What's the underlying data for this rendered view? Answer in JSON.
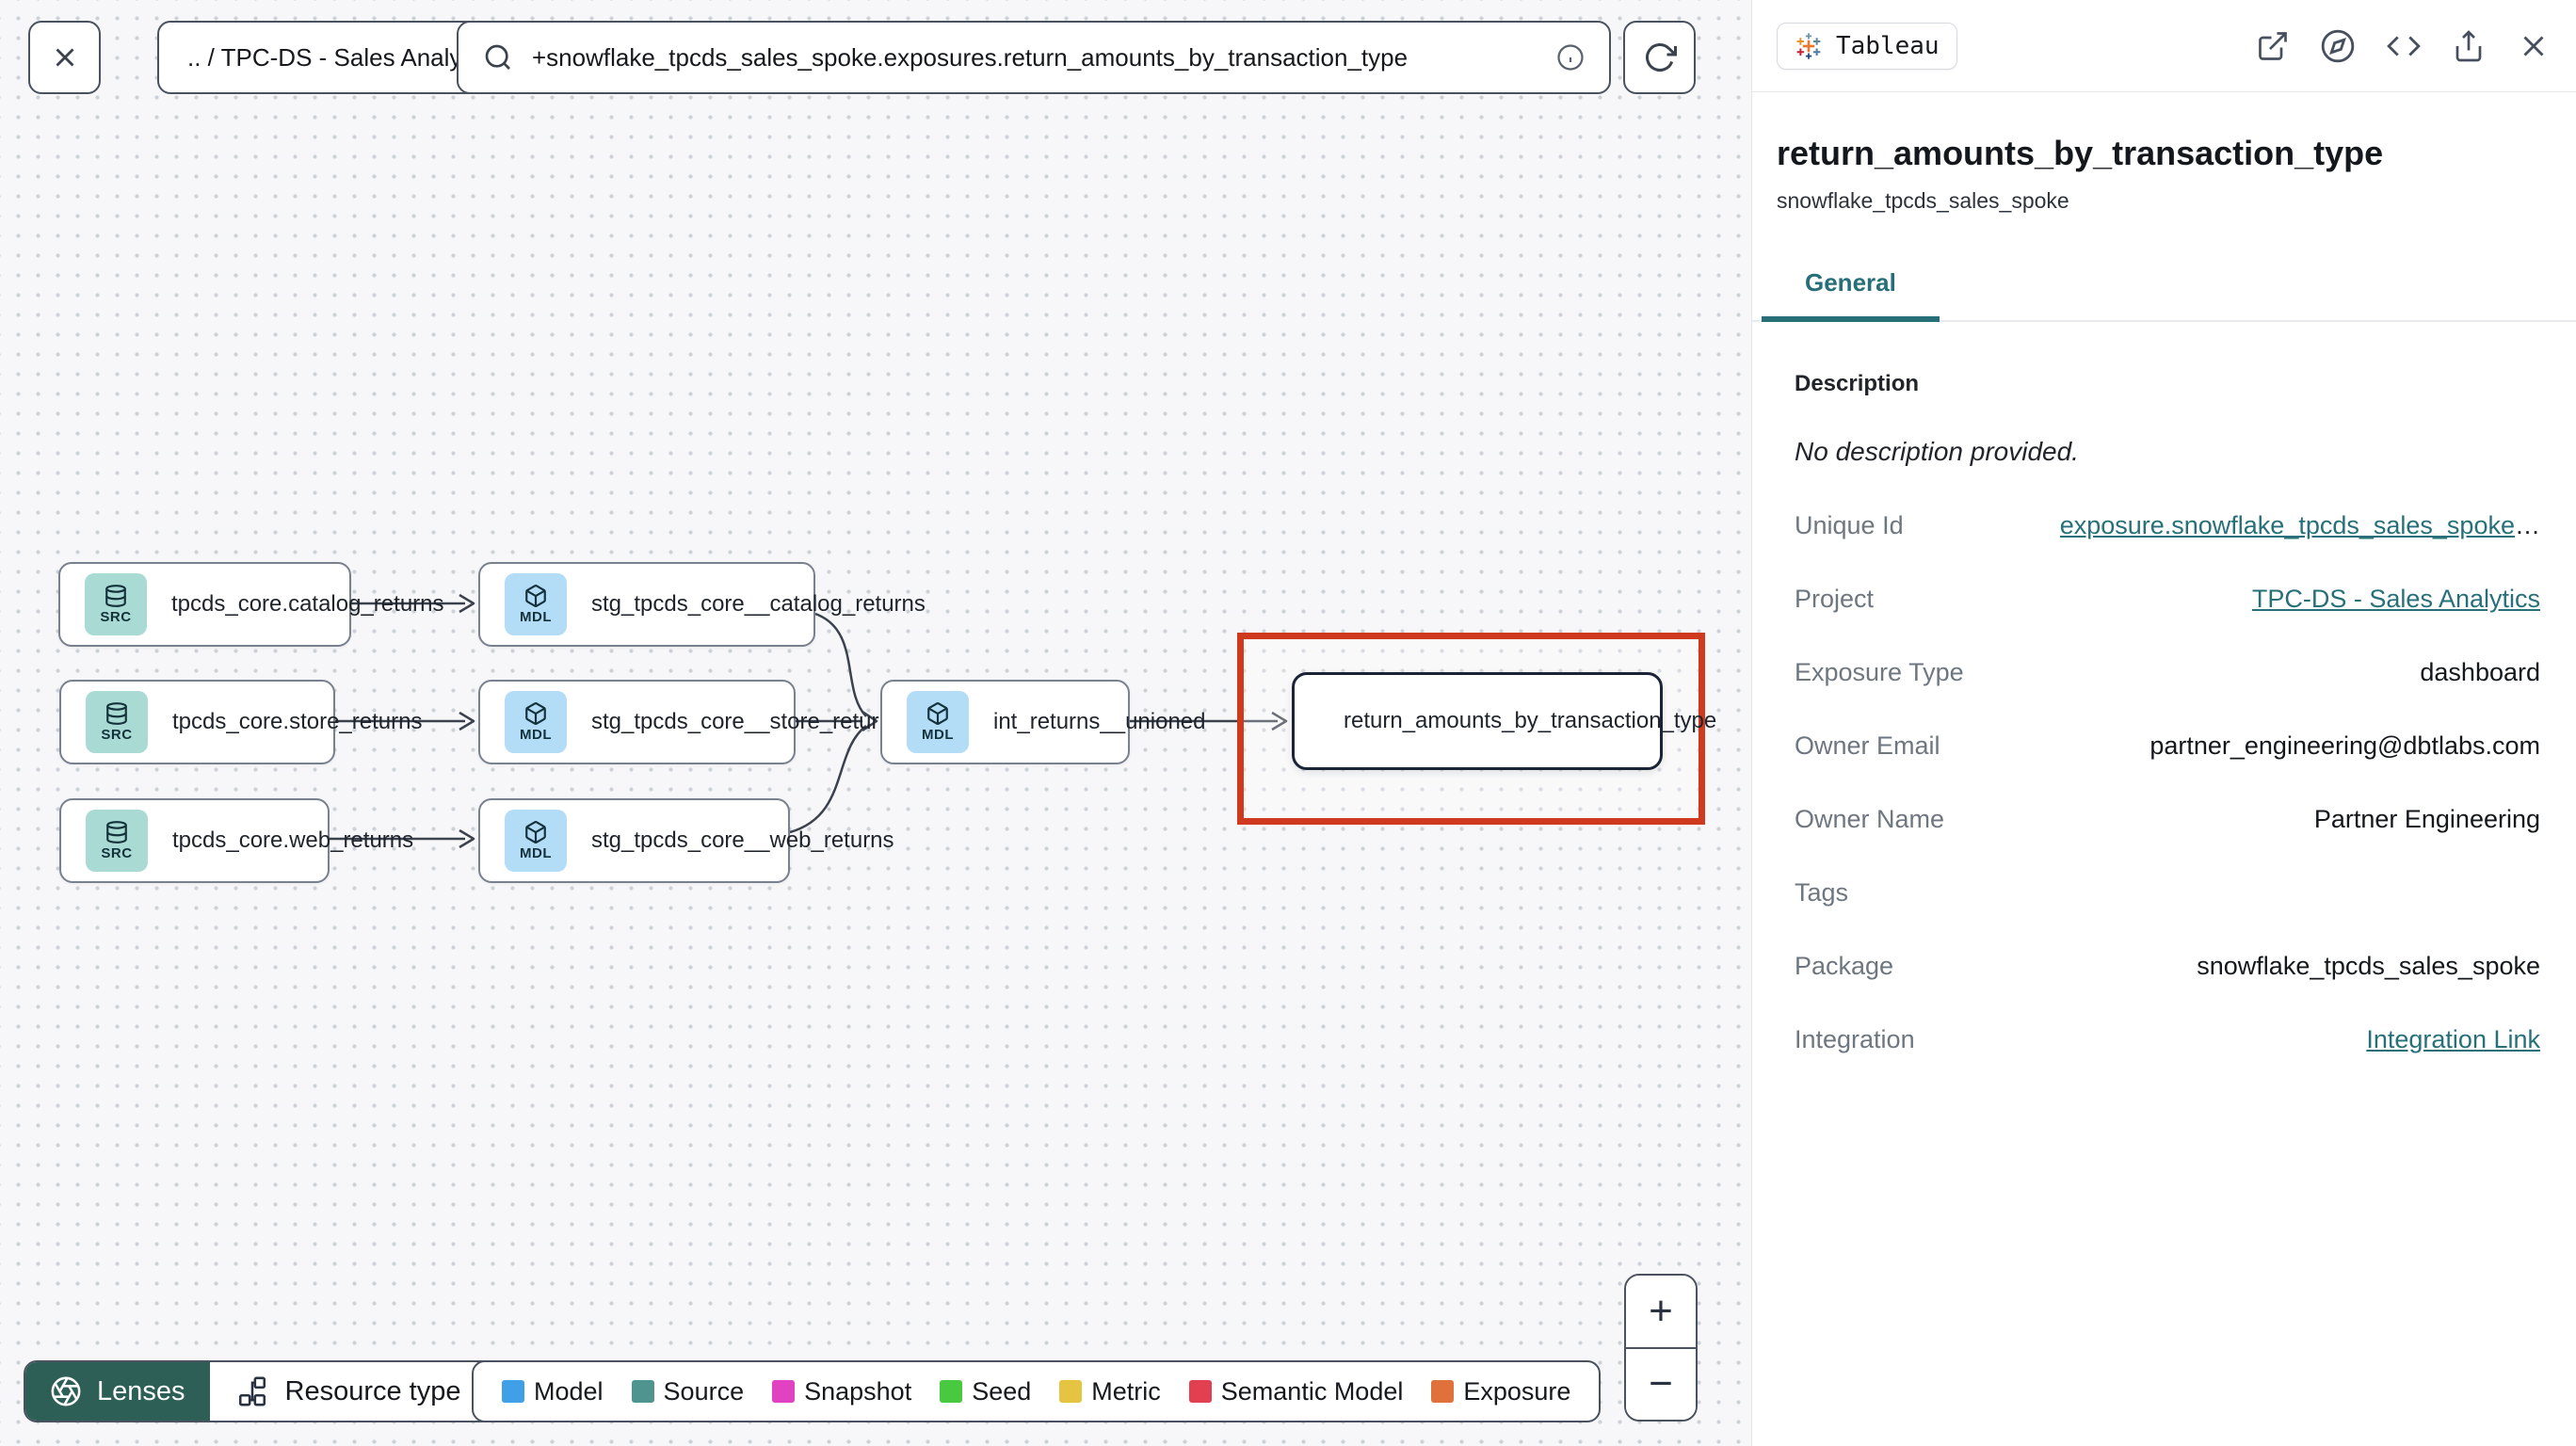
{
  "header": {
    "breadcrumb": ".. / TPC-DS - Sales Analytics",
    "search_value": "+snowflake_tpcds_sales_spoke.exposures.return_amounts_by_transaction_type"
  },
  "panel": {
    "integration_badge": "Tableau",
    "title": "return_amounts_by_transaction_type",
    "subtitle": "snowflake_tpcds_sales_spoke",
    "tab": "General",
    "description_label": "Description",
    "description_empty": "No description provided.",
    "rows": [
      {
        "label": "Unique Id",
        "value": "exposure.snowflake_tpcds_sales_spoke",
        "suffix": "…"
      },
      {
        "label": "Project",
        "value": "TPC-DS - Sales Analytics"
      },
      {
        "label": "Exposure Type",
        "value": "dashboard"
      },
      {
        "label": "Owner Email",
        "value": "partner_engineering@dbtlabs.com"
      },
      {
        "label": "Owner Name",
        "value": "Partner Engineering"
      },
      {
        "label": "Tags",
        "value": ""
      },
      {
        "label": "Package",
        "value": "snowflake_tpcds_sales_spoke"
      },
      {
        "label": "Integration",
        "value": "Integration Link"
      }
    ]
  },
  "graph": {
    "nodes": [
      {
        "badge": "SRC",
        "label": "tpcds_core.catalog_returns"
      },
      {
        "badge": "SRC",
        "label": "tpcds_core.store_returns"
      },
      {
        "badge": "SRC",
        "label": "tpcds_core.web_returns"
      },
      {
        "badge": "MDL",
        "label": "stg_tpcds_core__catalog_returns"
      },
      {
        "badge": "MDL",
        "label": "stg_tpcds_core__store_returns"
      },
      {
        "badge": "MDL",
        "label": "stg_tpcds_core__web_returns"
      },
      {
        "badge": "MDL",
        "label": "int_returns__unioned"
      },
      {
        "badge": "",
        "label": "return_amounts_by_transaction_type"
      }
    ],
    "lenses_label": "Lenses",
    "resource_type_label": "Resource type",
    "legend": [
      {
        "label": "Model",
        "color": "#3fa0e8"
      },
      {
        "label": "Source",
        "color": "#4e958f"
      },
      {
        "label": "Snapshot",
        "color": "#e042c1"
      },
      {
        "label": "Seed",
        "color": "#49c93f"
      },
      {
        "label": "Metric",
        "color": "#e5c441"
      },
      {
        "label": "Semantic Model",
        "color": "#e24051"
      },
      {
        "label": "Exposure",
        "color": "#e0713a"
      }
    ]
  },
  "zoom_controls": {
    "zoom_in": "+",
    "zoom_out": "−"
  },
  "colors": {
    "selection": "#cf3a1f",
    "accent_teal": "#266e78",
    "lenses_green": "#2d5f56"
  }
}
